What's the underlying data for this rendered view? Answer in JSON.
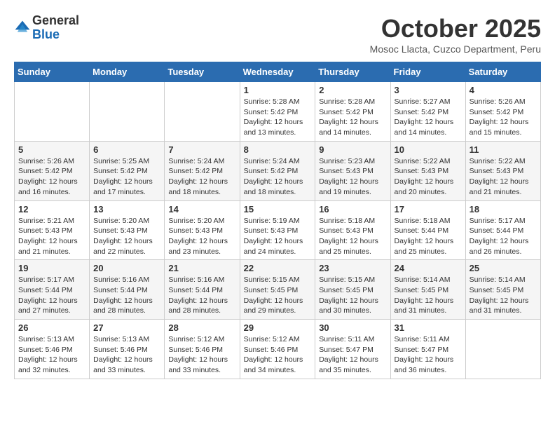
{
  "header": {
    "logo_general": "General",
    "logo_blue": "Blue",
    "month_title": "October 2025",
    "subtitle": "Mosoc Llacta, Cuzco Department, Peru"
  },
  "days_of_week": [
    "Sunday",
    "Monday",
    "Tuesday",
    "Wednesday",
    "Thursday",
    "Friday",
    "Saturday"
  ],
  "weeks": [
    [
      {
        "day": "",
        "info": ""
      },
      {
        "day": "",
        "info": ""
      },
      {
        "day": "",
        "info": ""
      },
      {
        "day": "1",
        "info": "Sunrise: 5:28 AM\nSunset: 5:42 PM\nDaylight: 12 hours\nand 13 minutes."
      },
      {
        "day": "2",
        "info": "Sunrise: 5:28 AM\nSunset: 5:42 PM\nDaylight: 12 hours\nand 14 minutes."
      },
      {
        "day": "3",
        "info": "Sunrise: 5:27 AM\nSunset: 5:42 PM\nDaylight: 12 hours\nand 14 minutes."
      },
      {
        "day": "4",
        "info": "Sunrise: 5:26 AM\nSunset: 5:42 PM\nDaylight: 12 hours\nand 15 minutes."
      }
    ],
    [
      {
        "day": "5",
        "info": "Sunrise: 5:26 AM\nSunset: 5:42 PM\nDaylight: 12 hours\nand 16 minutes."
      },
      {
        "day": "6",
        "info": "Sunrise: 5:25 AM\nSunset: 5:42 PM\nDaylight: 12 hours\nand 17 minutes."
      },
      {
        "day": "7",
        "info": "Sunrise: 5:24 AM\nSunset: 5:42 PM\nDaylight: 12 hours\nand 18 minutes."
      },
      {
        "day": "8",
        "info": "Sunrise: 5:24 AM\nSunset: 5:42 PM\nDaylight: 12 hours\nand 18 minutes."
      },
      {
        "day": "9",
        "info": "Sunrise: 5:23 AM\nSunset: 5:43 PM\nDaylight: 12 hours\nand 19 minutes."
      },
      {
        "day": "10",
        "info": "Sunrise: 5:22 AM\nSunset: 5:43 PM\nDaylight: 12 hours\nand 20 minutes."
      },
      {
        "day": "11",
        "info": "Sunrise: 5:22 AM\nSunset: 5:43 PM\nDaylight: 12 hours\nand 21 minutes."
      }
    ],
    [
      {
        "day": "12",
        "info": "Sunrise: 5:21 AM\nSunset: 5:43 PM\nDaylight: 12 hours\nand 21 minutes."
      },
      {
        "day": "13",
        "info": "Sunrise: 5:20 AM\nSunset: 5:43 PM\nDaylight: 12 hours\nand 22 minutes."
      },
      {
        "day": "14",
        "info": "Sunrise: 5:20 AM\nSunset: 5:43 PM\nDaylight: 12 hours\nand 23 minutes."
      },
      {
        "day": "15",
        "info": "Sunrise: 5:19 AM\nSunset: 5:43 PM\nDaylight: 12 hours\nand 24 minutes."
      },
      {
        "day": "16",
        "info": "Sunrise: 5:18 AM\nSunset: 5:43 PM\nDaylight: 12 hours\nand 25 minutes."
      },
      {
        "day": "17",
        "info": "Sunrise: 5:18 AM\nSunset: 5:44 PM\nDaylight: 12 hours\nand 25 minutes."
      },
      {
        "day": "18",
        "info": "Sunrise: 5:17 AM\nSunset: 5:44 PM\nDaylight: 12 hours\nand 26 minutes."
      }
    ],
    [
      {
        "day": "19",
        "info": "Sunrise: 5:17 AM\nSunset: 5:44 PM\nDaylight: 12 hours\nand 27 minutes."
      },
      {
        "day": "20",
        "info": "Sunrise: 5:16 AM\nSunset: 5:44 PM\nDaylight: 12 hours\nand 28 minutes."
      },
      {
        "day": "21",
        "info": "Sunrise: 5:16 AM\nSunset: 5:44 PM\nDaylight: 12 hours\nand 28 minutes."
      },
      {
        "day": "22",
        "info": "Sunrise: 5:15 AM\nSunset: 5:45 PM\nDaylight: 12 hours\nand 29 minutes."
      },
      {
        "day": "23",
        "info": "Sunrise: 5:15 AM\nSunset: 5:45 PM\nDaylight: 12 hours\nand 30 minutes."
      },
      {
        "day": "24",
        "info": "Sunrise: 5:14 AM\nSunset: 5:45 PM\nDaylight: 12 hours\nand 31 minutes."
      },
      {
        "day": "25",
        "info": "Sunrise: 5:14 AM\nSunset: 5:45 PM\nDaylight: 12 hours\nand 31 minutes."
      }
    ],
    [
      {
        "day": "26",
        "info": "Sunrise: 5:13 AM\nSunset: 5:46 PM\nDaylight: 12 hours\nand 32 minutes."
      },
      {
        "day": "27",
        "info": "Sunrise: 5:13 AM\nSunset: 5:46 PM\nDaylight: 12 hours\nand 33 minutes."
      },
      {
        "day": "28",
        "info": "Sunrise: 5:12 AM\nSunset: 5:46 PM\nDaylight: 12 hours\nand 33 minutes."
      },
      {
        "day": "29",
        "info": "Sunrise: 5:12 AM\nSunset: 5:46 PM\nDaylight: 12 hours\nand 34 minutes."
      },
      {
        "day": "30",
        "info": "Sunrise: 5:11 AM\nSunset: 5:47 PM\nDaylight: 12 hours\nand 35 minutes."
      },
      {
        "day": "31",
        "info": "Sunrise: 5:11 AM\nSunset: 5:47 PM\nDaylight: 12 hours\nand 36 minutes."
      },
      {
        "day": "",
        "info": ""
      }
    ]
  ]
}
